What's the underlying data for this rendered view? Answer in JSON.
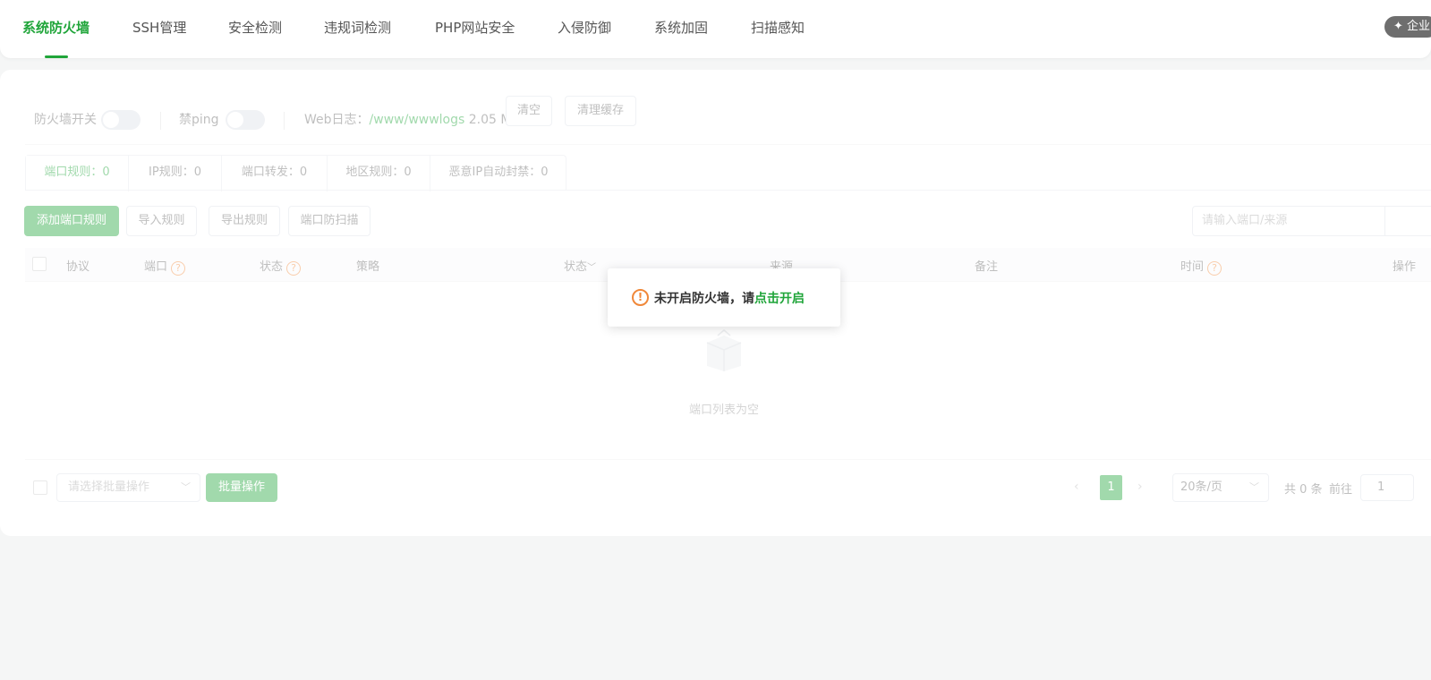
{
  "nav": {
    "tabs": [
      {
        "label": "系统防火墙",
        "active": true
      },
      {
        "label": "SSH管理"
      },
      {
        "label": "安全检测"
      },
      {
        "label": "违规词检测"
      },
      {
        "label": "PHP网站安全"
      },
      {
        "label": "入侵防御"
      },
      {
        "label": "系统加固"
      },
      {
        "label": "扫描感知"
      }
    ],
    "enterprise_badge": "企业"
  },
  "toolbar": {
    "firewall_switch_label": "防火墙开关",
    "firewall_switch_on": false,
    "ping_switch_label": "禁ping",
    "ping_switch_on": false,
    "weblog_label": "Web日志：",
    "weblog_path": "/www/wwwlogs",
    "weblog_size": "2.05 MB",
    "clear_button": "清空",
    "clear_cache_button": "清理缓存"
  },
  "rule_tabs": [
    {
      "label": "端口规则：0",
      "active": true
    },
    {
      "label": "IP规则：0"
    },
    {
      "label": "端口转发：0"
    },
    {
      "label": "地区规则：0"
    },
    {
      "label": "恶意IP自动封禁：0"
    }
  ],
  "actions": {
    "add_button": "添加端口规则",
    "import_button": "导入规则",
    "export_button": "导出规则",
    "scan_button": "端口防扫描",
    "search_placeholder": "请输入端口/来源"
  },
  "table": {
    "columns": [
      "协议",
      "端口",
      "状态",
      "策略",
      "状态",
      "来源",
      "备注",
      "时间",
      "操作"
    ],
    "empty_text": "端口列表为空"
  },
  "footer": {
    "batch_placeholder": "请选择批量操作",
    "batch_button": "批量操作",
    "current_page": "1",
    "page_size": "20条/页",
    "total": "共 0 条",
    "goto_label": "前往",
    "goto_value": "1"
  },
  "message": {
    "text": "未开启防火墙，请",
    "link": "点击开启"
  }
}
